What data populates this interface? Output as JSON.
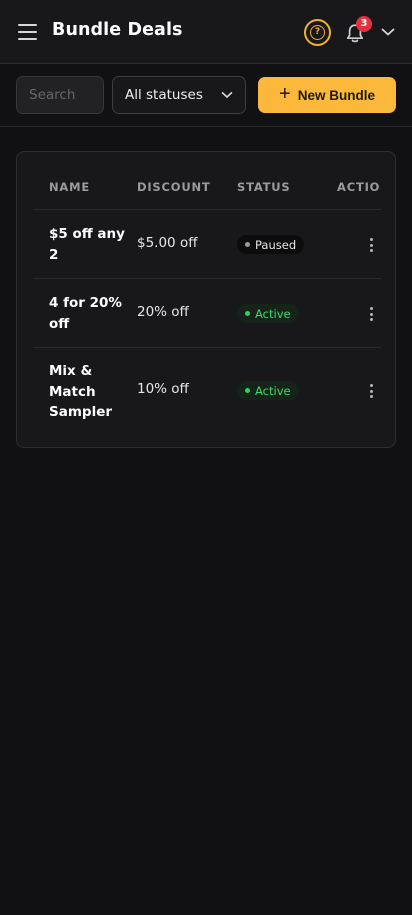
{
  "header": {
    "title": "Bundle Deals",
    "help_symbol": "?",
    "notifications_count": "3"
  },
  "toolbar": {
    "search_placeholder": "Search",
    "status_filter": "All statuses",
    "new_bundle_label": "New Bundle"
  },
  "table": {
    "columns": [
      "NAME",
      "DISCOUNT",
      "STATUS",
      "ACTIONS"
    ],
    "rows": [
      {
        "name": "$5 off any 2",
        "discount": "$5.00 off",
        "status": "Paused"
      },
      {
        "name": "4 for 20% off",
        "discount": "20% off",
        "status": "Active"
      },
      {
        "name": "Mix & Match Sampler",
        "discount": "10% off",
        "status": "Active"
      }
    ]
  },
  "colors": {
    "accent": "#fbb83a",
    "active": "#3ddc6b",
    "badge": "#e5303f"
  }
}
